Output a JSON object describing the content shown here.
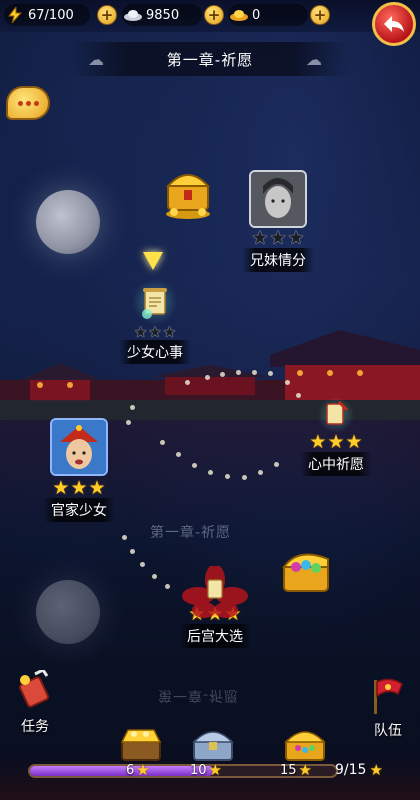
{
  "topbar": {
    "energy": "67/100",
    "silver": "9850",
    "gold": "0"
  },
  "chapter_title": "第一章-祈愿",
  "faint_title": "第一章-祈愿",
  "faint_title_reflection": "第一章-祈愿",
  "nodes": [
    {
      "label": "兄妹情分",
      "stars": 0
    },
    {
      "label": "少女心事",
      "stars": 0
    },
    {
      "label": "心中祈愿",
      "stars": 3
    },
    {
      "label": "官家少女",
      "stars": 3
    },
    {
      "label": "后宫大选",
      "stars": 3
    }
  ],
  "side": {
    "task_label": "任务",
    "team_label": "队伍"
  },
  "progress": {
    "current": 9,
    "max": 15,
    "total_text": "9/15",
    "milestones": [
      "6",
      "10",
      "15"
    ]
  }
}
